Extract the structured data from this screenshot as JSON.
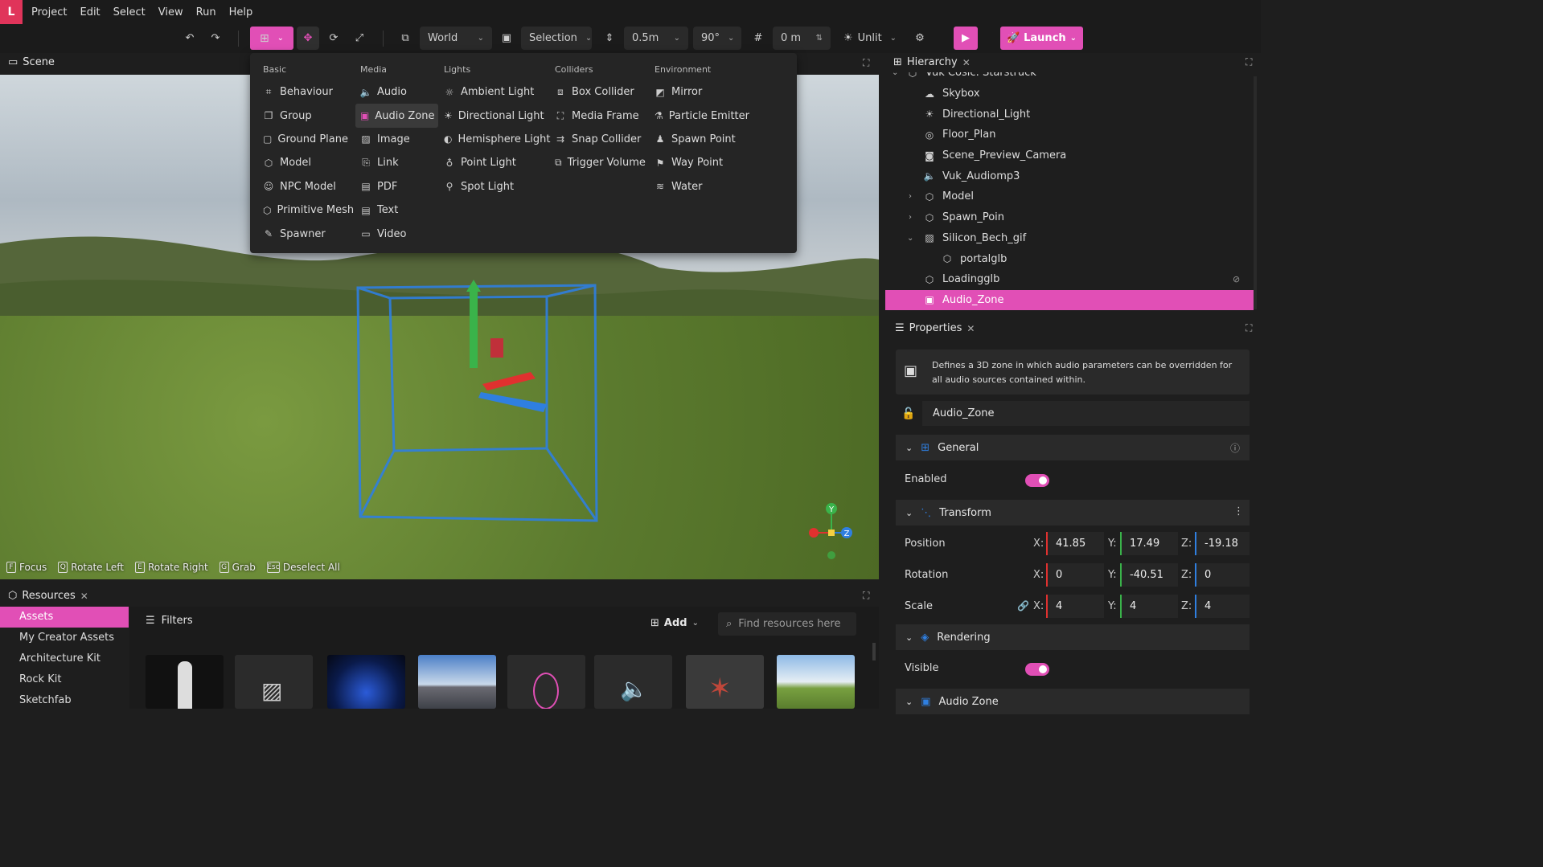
{
  "app": {
    "logo_letter": "L"
  },
  "menubar": [
    "Project",
    "Edit",
    "Select",
    "View",
    "Run",
    "Help"
  ],
  "toolbar": {
    "space": "World",
    "pivot": "Selection",
    "snap_distance": "0.5m",
    "snap_angle": "90°",
    "grid": "0 m",
    "lighting": "Unlit",
    "launch": "Launch"
  },
  "scene": {
    "tab": "Scene"
  },
  "add_menu": {
    "columns": [
      {
        "header": "Basic",
        "items": [
          {
            "label": "Behaviour",
            "icon": "behaviour-icon"
          },
          {
            "label": "Group",
            "icon": "group-icon"
          },
          {
            "label": "Ground Plane",
            "icon": "ground-plane-icon"
          },
          {
            "label": "Model",
            "icon": "model-icon"
          },
          {
            "label": "NPC Model",
            "icon": "npc-icon"
          },
          {
            "label": "Primitive Mesh",
            "icon": "primitive-icon"
          },
          {
            "label": "Spawner",
            "icon": "spawner-icon"
          }
        ]
      },
      {
        "header": "Media",
        "items": [
          {
            "label": "Audio",
            "icon": "audio-icon"
          },
          {
            "label": "Audio Zone",
            "icon": "audio-zone-icon"
          },
          {
            "label": "Image",
            "icon": "image-icon"
          },
          {
            "label": "Link",
            "icon": "link-icon"
          },
          {
            "label": "PDF",
            "icon": "pdf-icon"
          },
          {
            "label": "Text",
            "icon": "text-icon"
          },
          {
            "label": "Video",
            "icon": "video-icon"
          }
        ]
      },
      {
        "header": "Lights",
        "items": [
          {
            "label": "Ambient Light",
            "icon": "ambient-light-icon"
          },
          {
            "label": "Directional Light",
            "icon": "directional-light-icon"
          },
          {
            "label": "Hemisphere Light",
            "icon": "hemisphere-light-icon"
          },
          {
            "label": "Point Light",
            "icon": "point-light-icon"
          },
          {
            "label": "Spot Light",
            "icon": "spot-light-icon"
          }
        ]
      },
      {
        "header": "Colliders",
        "items": [
          {
            "label": "Box Collider",
            "icon": "box-collider-icon"
          },
          {
            "label": "Media Frame",
            "icon": "media-frame-icon"
          },
          {
            "label": "Snap Collider",
            "icon": "snap-collider-icon"
          },
          {
            "label": "Trigger Volume",
            "icon": "trigger-volume-icon"
          }
        ]
      },
      {
        "header": "Environment",
        "items": [
          {
            "label": "Mirror",
            "icon": "mirror-icon"
          },
          {
            "label": "Particle Emitter",
            "icon": "particle-emitter-icon"
          },
          {
            "label": "Spawn Point",
            "icon": "spawn-point-icon"
          },
          {
            "label": "Way Point",
            "icon": "way-point-icon"
          },
          {
            "label": "Water",
            "icon": "water-icon"
          }
        ]
      }
    ],
    "selected": "Audio Zone"
  },
  "viewport": {
    "hints": [
      {
        "key": "F",
        "label": "Focus"
      },
      {
        "key": "Q",
        "label": "Rotate Left"
      },
      {
        "key": "E",
        "label": "Rotate Right"
      },
      {
        "key": "G",
        "label": "Grab"
      },
      {
        "key": "Esc",
        "label": "Deselect All"
      }
    ],
    "gizmo_axes": [
      "Y",
      "Z"
    ]
  },
  "hierarchy": {
    "tab": "Hierarchy",
    "items": [
      {
        "label": "Vuk Cosic: Starstruck",
        "depth": 0,
        "caret": "down"
      },
      {
        "label": "Skybox",
        "depth": 1
      },
      {
        "label": "Directional_Light",
        "depth": 1
      },
      {
        "label": "Floor_Plan",
        "depth": 1
      },
      {
        "label": "Scene_Preview_Camera",
        "depth": 1
      },
      {
        "label": "Vuk_Audiomp3",
        "depth": 1
      },
      {
        "label": "Model",
        "depth": 1,
        "caret": "right"
      },
      {
        "label": "Spawn_Poin",
        "depth": 1,
        "caret": "right"
      },
      {
        "label": "Silicon_Bech_gif",
        "depth": 1,
        "caret": "down"
      },
      {
        "label": "portalglb",
        "depth": 2
      },
      {
        "label": "Loadingglb",
        "depth": 1,
        "hidden": true
      },
      {
        "label": "Audio_Zone",
        "depth": 1,
        "selected": true
      }
    ]
  },
  "properties": {
    "tab": "Properties",
    "description": "Defines a 3D zone in which audio parameters can be overridden for all audio sources contained within.",
    "name": "Audio_Zone",
    "general": {
      "title": "General",
      "enabled_label": "Enabled",
      "enabled": true
    },
    "transform": {
      "title": "Transform",
      "position": {
        "label": "Position",
        "x": "41.85",
        "y": "17.49",
        "z": "-19.18"
      },
      "rotation": {
        "label": "Rotation",
        "x": "0",
        "y": "-40.51",
        "z": "0"
      },
      "scale": {
        "label": "Scale",
        "x": "4",
        "y": "4",
        "z": "4"
      }
    },
    "rendering": {
      "title": "Rendering",
      "visible_label": "Visible",
      "visible": true
    },
    "audio_zone": {
      "title": "Audio Zone"
    }
  },
  "resources": {
    "tab": "Resources",
    "categories": [
      "Assets",
      "My Creator Assets",
      "Architecture Kit",
      "Rock Kit",
      "Sketchfab"
    ],
    "selected": "Assets",
    "filters": "Filters",
    "add": "Add",
    "search_placeholder": "Find resources here"
  },
  "colors": {
    "accent": "#e14fb6",
    "x_axis": "#e0312f",
    "y_axis": "#3ab34a",
    "z_axis": "#2f7fe0"
  }
}
